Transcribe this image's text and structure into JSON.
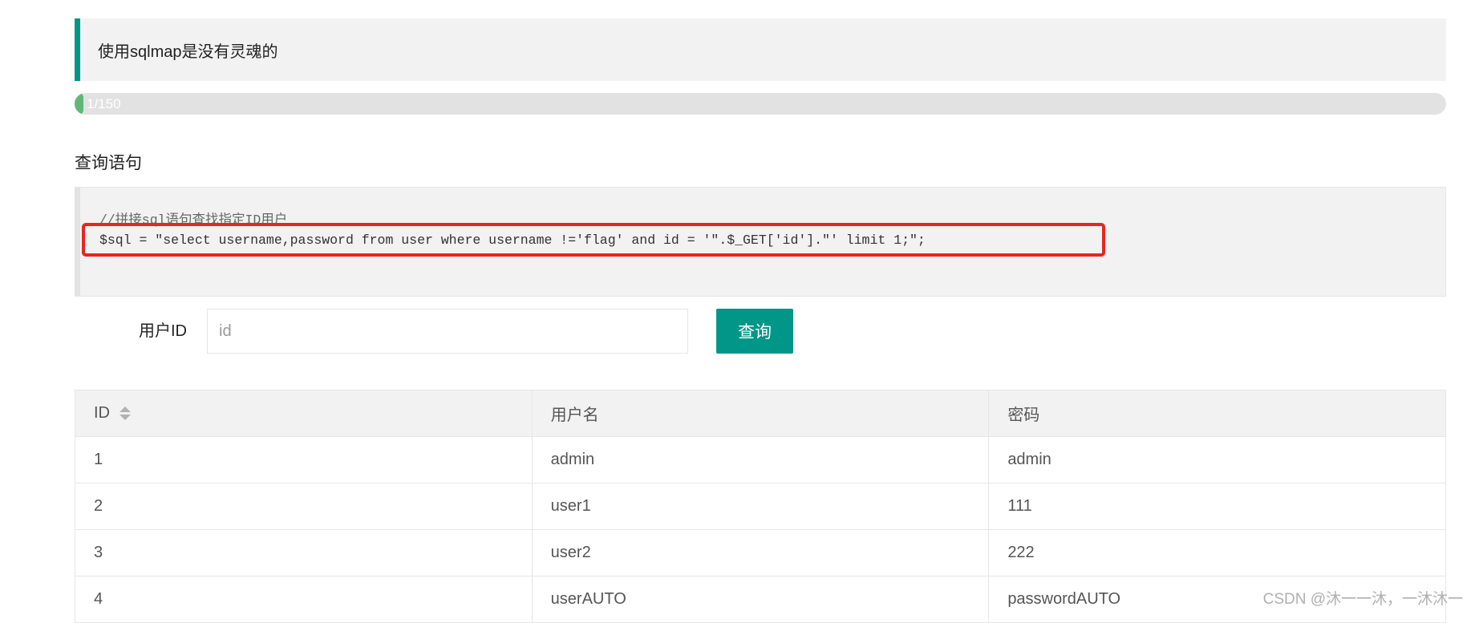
{
  "notice": {
    "text": "使用sqlmap是没有灵魂的"
  },
  "progress": {
    "label": "1/150",
    "value": 1,
    "max": 150,
    "fill_color": "#5fb878"
  },
  "query": {
    "title": "查询语句",
    "comment": "//拼接sql语句查找指定ID用户",
    "code": "$sql = \"select username,password from user where username !='flag' and id = '\".$_GET['id'].\"' limit 1;\";"
  },
  "form": {
    "label": "用户ID",
    "input_placeholder": "id",
    "input_value": "",
    "button_label": "查询",
    "button_color": "#009688"
  },
  "table": {
    "headers": [
      "ID",
      "用户名",
      "密码"
    ],
    "rows": [
      [
        "1",
        "admin",
        "admin"
      ],
      [
        "2",
        "user1",
        "111"
      ],
      [
        "3",
        "user2",
        "222"
      ],
      [
        "4",
        "userAUTO",
        "passwordAUTO"
      ]
    ],
    "sort_icon": "sort-arrows-icon"
  },
  "highlight_color": "#e8261f",
  "watermark": "CSDN @沐一一沐，一沐沐一"
}
